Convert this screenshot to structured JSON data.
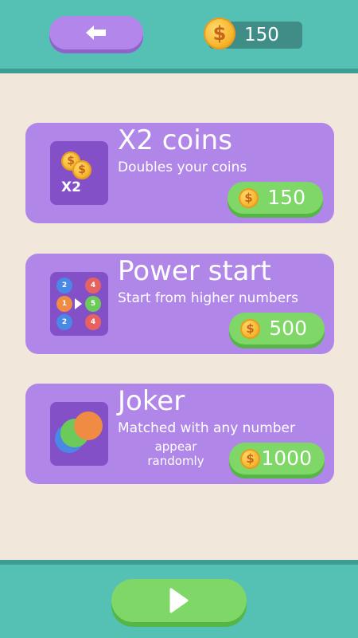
{
  "header": {
    "back_icon": "arrow-left-icon",
    "coin_icon": "coin-icon",
    "coin_symbol": "$",
    "coin_count": "150"
  },
  "shop": {
    "items": [
      {
        "title": "X2 coins",
        "description": "Doubles your coins",
        "price": "150",
        "icon": "double-coins-icon",
        "icon_text": "X2"
      },
      {
        "title": "Power start",
        "description": "Start from higher numbers",
        "price": "500",
        "icon": "number-grid-icon",
        "grid_numbers": [
          "2",
          "4",
          "1",
          "5",
          "2",
          "4"
        ]
      },
      {
        "title": "Joker",
        "description": "Matched with any number",
        "note": "appear randomly",
        "price": "1000",
        "icon": "joker-circles-icon"
      }
    ]
  },
  "footer": {
    "play_icon": "play-icon"
  },
  "colors": {
    "teal": "#55c0b4",
    "purple_card": "#b087e8",
    "purple_icon": "#8350c8",
    "green_button": "#7ed766",
    "coin_gold": "#f6b52d"
  }
}
